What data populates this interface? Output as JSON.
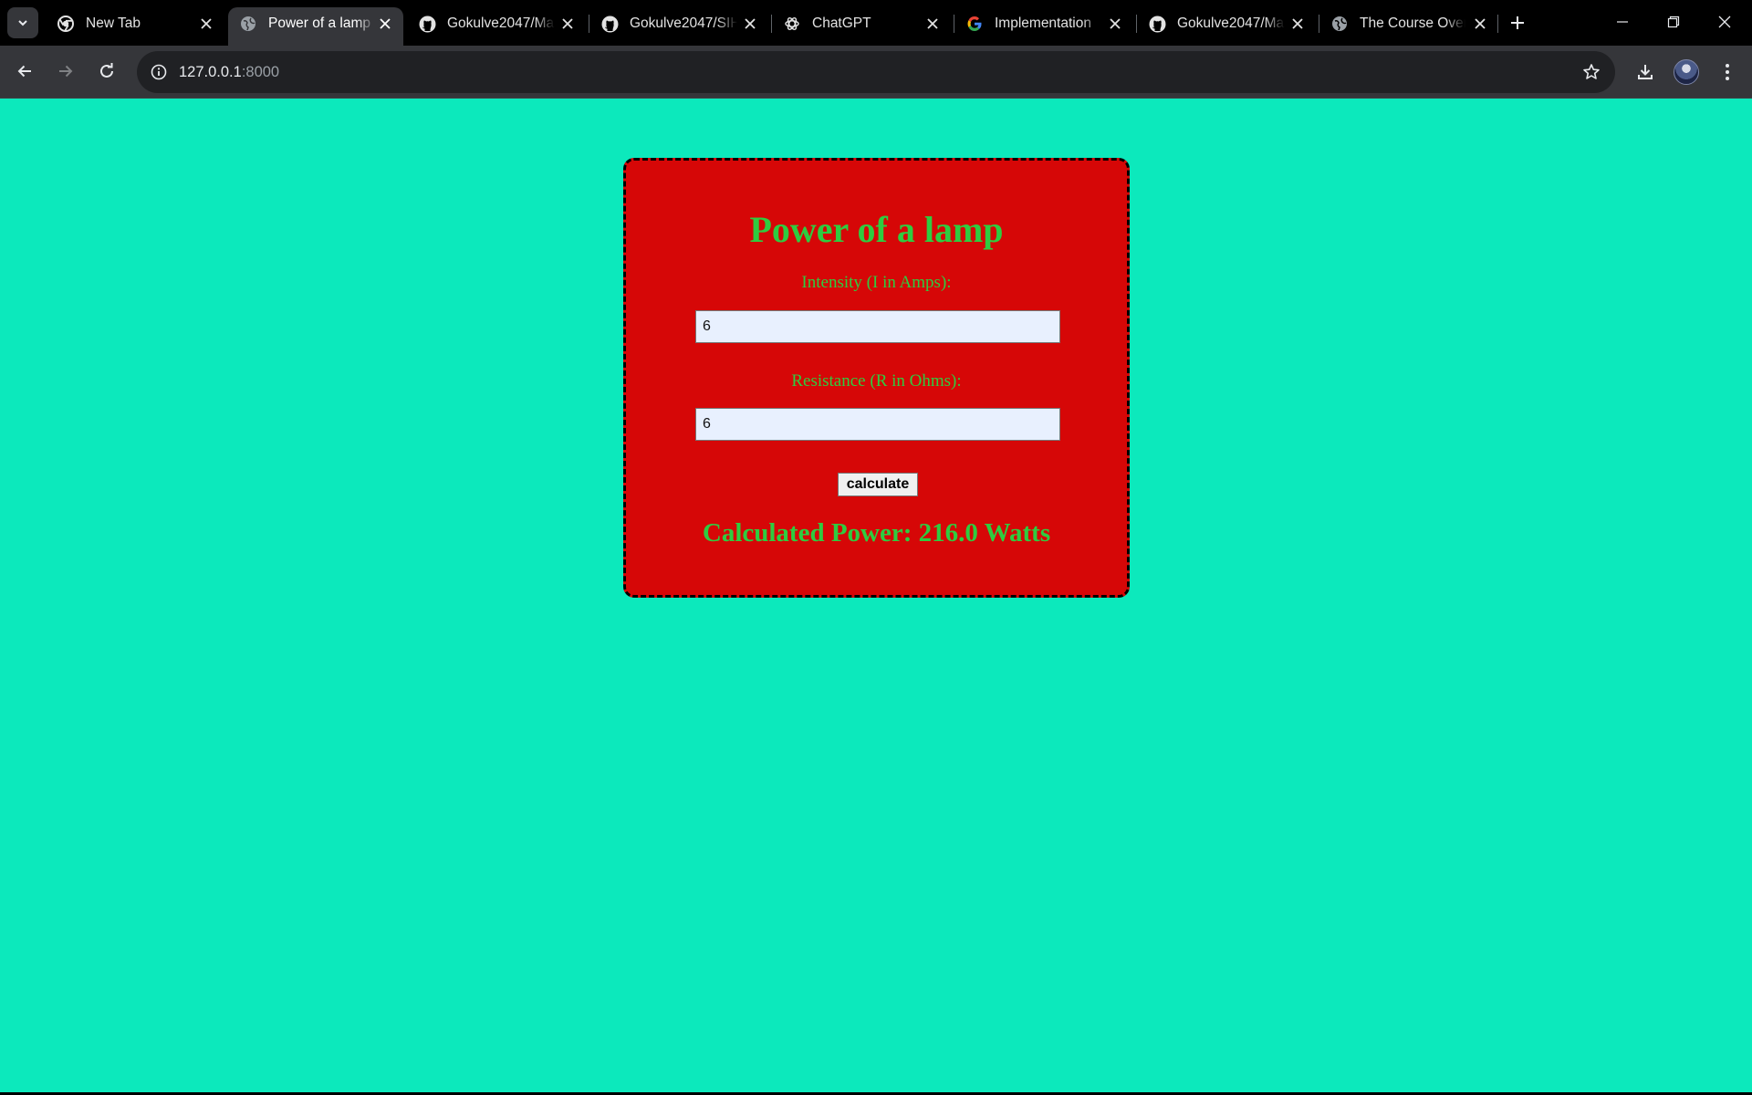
{
  "browser": {
    "tabs": [
      {
        "title": "New Tab",
        "icon": "chrome-icon",
        "active": false
      },
      {
        "title": "Power of a lamp",
        "icon": "globe-icon",
        "active": true
      },
      {
        "title": "Gokulve2047/Ma",
        "icon": "github-icon",
        "active": false
      },
      {
        "title": "Gokulve2047/SIH",
        "icon": "github-icon",
        "active": false
      },
      {
        "title": "ChatGPT",
        "icon": "chatgpt-icon",
        "active": false
      },
      {
        "title": "Implementation",
        "icon": "google-icon",
        "active": false
      },
      {
        "title": "Gokulve2047/Ma",
        "icon": "github-icon",
        "active": false
      },
      {
        "title": "The Course Over",
        "icon": "globe-icon",
        "active": false
      }
    ],
    "url_host": "127.0.0.1",
    "url_port": ":8000"
  },
  "form": {
    "title": "Power of a lamp",
    "intensity_label": "Intensity (I in Amps):",
    "intensity_value": "6",
    "resistance_label": "Resistance (R in Ohms):",
    "resistance_value": "6",
    "button_label": "calculate",
    "result": "Calculated Power: 216.0 Watts"
  },
  "colors": {
    "page_background": "#0ce9bc",
    "card_background": "#d60707",
    "text_green": "#2ecc40",
    "tab_strip": "#000000",
    "toolbar": "#35363a"
  }
}
